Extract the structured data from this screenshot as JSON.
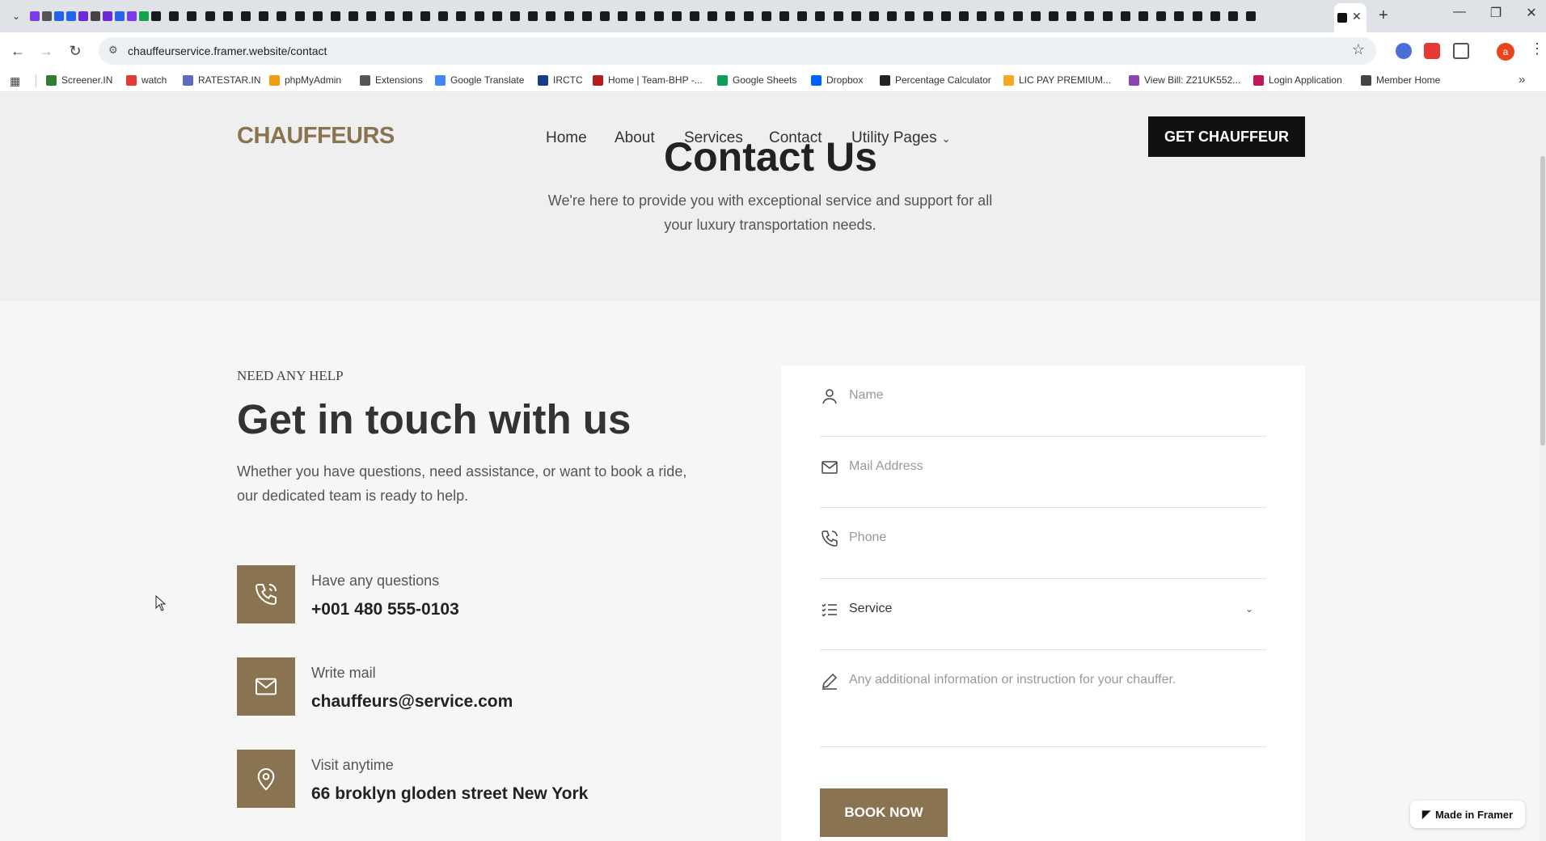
{
  "browser": {
    "url": "chauffeurservice.framer.website/contact",
    "tab_close": "✕",
    "new_tab": "+",
    "bookmarks": [
      {
        "label": "Screener.IN",
        "color": "#2e7d32"
      },
      {
        "label": "watch",
        "color": "#e53935"
      },
      {
        "label": "RATESTAR.IN",
        "color": "#5c6bc0"
      },
      {
        "label": "phpMyAdmin",
        "color": "#f39c12"
      },
      {
        "label": "Extensions",
        "color": "#555555"
      },
      {
        "label": "Google Translate",
        "color": "#4285f4"
      },
      {
        "label": "IRCTC",
        "color": "#1a3a8a"
      },
      {
        "label": "Home | Team-BHP -...",
        "color": "#b71c1c"
      },
      {
        "label": "Google Sheets",
        "color": "#0f9d58"
      },
      {
        "label": "Dropbox",
        "color": "#0061ff"
      },
      {
        "label": "Percentage Calculator",
        "color": "#222222"
      },
      {
        "label": "LIC PAY PREMIUM...",
        "color": "#f9a825"
      },
      {
        "label": "View Bill: Z21UK552...",
        "color": "#8e44ad"
      },
      {
        "label": "Login Application",
        "color": "#c2185b"
      },
      {
        "label": "Member Home",
        "color": "#444444"
      }
    ],
    "profile_initial": "a"
  },
  "header": {
    "logo": "CHAUFFEURS",
    "nav": [
      "Home",
      "About",
      "Services",
      "Contact",
      "Utility Pages"
    ],
    "cta": "GET CHAUFFEUR"
  },
  "hero": {
    "title": "Contact Us",
    "subtitle": "We're here to provide you with exceptional service and support for all your luxury transportation needs."
  },
  "contact": {
    "eyebrow": "NEED ANY HELP",
    "heading": "Get in touch with us",
    "lead": "Whether you have questions, need assistance, or want to book a ride, our dedicated team is ready to help.",
    "items": [
      {
        "label": "Have any questions",
        "value": "+001 480 555-0103",
        "icon": "phone-icon"
      },
      {
        "label": "Write mail",
        "value": "chauffeurs@service.com",
        "icon": "mail-icon"
      },
      {
        "label": "Visit anytime",
        "value": "66 broklyn gloden street New York",
        "icon": "location-pin-icon"
      }
    ]
  },
  "form": {
    "name_placeholder": "Name",
    "email_placeholder": "Mail Address",
    "phone_placeholder": "Phone",
    "service_value": "Service",
    "notes_placeholder": "Any additional information or instruction for your chauffer.",
    "submit": "BOOK NOW"
  },
  "badge": "Made in Framer",
  "colors": {
    "brand": "#8a7350",
    "dark": "#111111"
  }
}
